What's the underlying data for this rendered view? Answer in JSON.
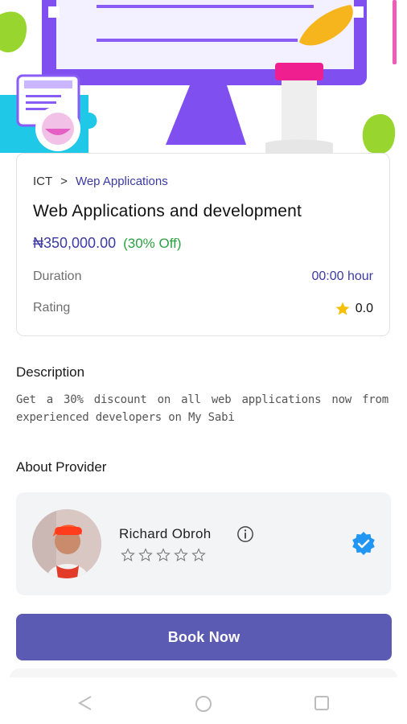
{
  "course": {
    "breadcrumb": {
      "category": "ICT",
      "separator": ">",
      "subcategory": "Wep Applications"
    },
    "title": "Web Applications and development",
    "price": "₦350,000.00",
    "discount": "(30% Off)",
    "duration_label": "Duration",
    "duration_value": "00:00 hour",
    "rating_label": "Rating",
    "rating_value": "0.0"
  },
  "description": {
    "heading": "Description",
    "text": "Get a 30% discount on all web applications now from experienced developers on My Sabi"
  },
  "provider": {
    "heading": "About Provider",
    "name": "Richard Obroh",
    "rating_stars": 0
  },
  "actions": {
    "book_label": "Book Now"
  },
  "colors": {
    "accent": "#3c3aa3",
    "button": "#5b5bb4",
    "discount_green": "#2ba142",
    "verified_blue": "#2196f3",
    "star_gold": "#f6c000"
  },
  "icons": {
    "star": "star-icon",
    "info": "info-icon",
    "verified": "verified-badge-icon",
    "nav_back": "nav-back-icon",
    "nav_home": "nav-home-icon",
    "nav_recents": "nav-recents-icon"
  }
}
